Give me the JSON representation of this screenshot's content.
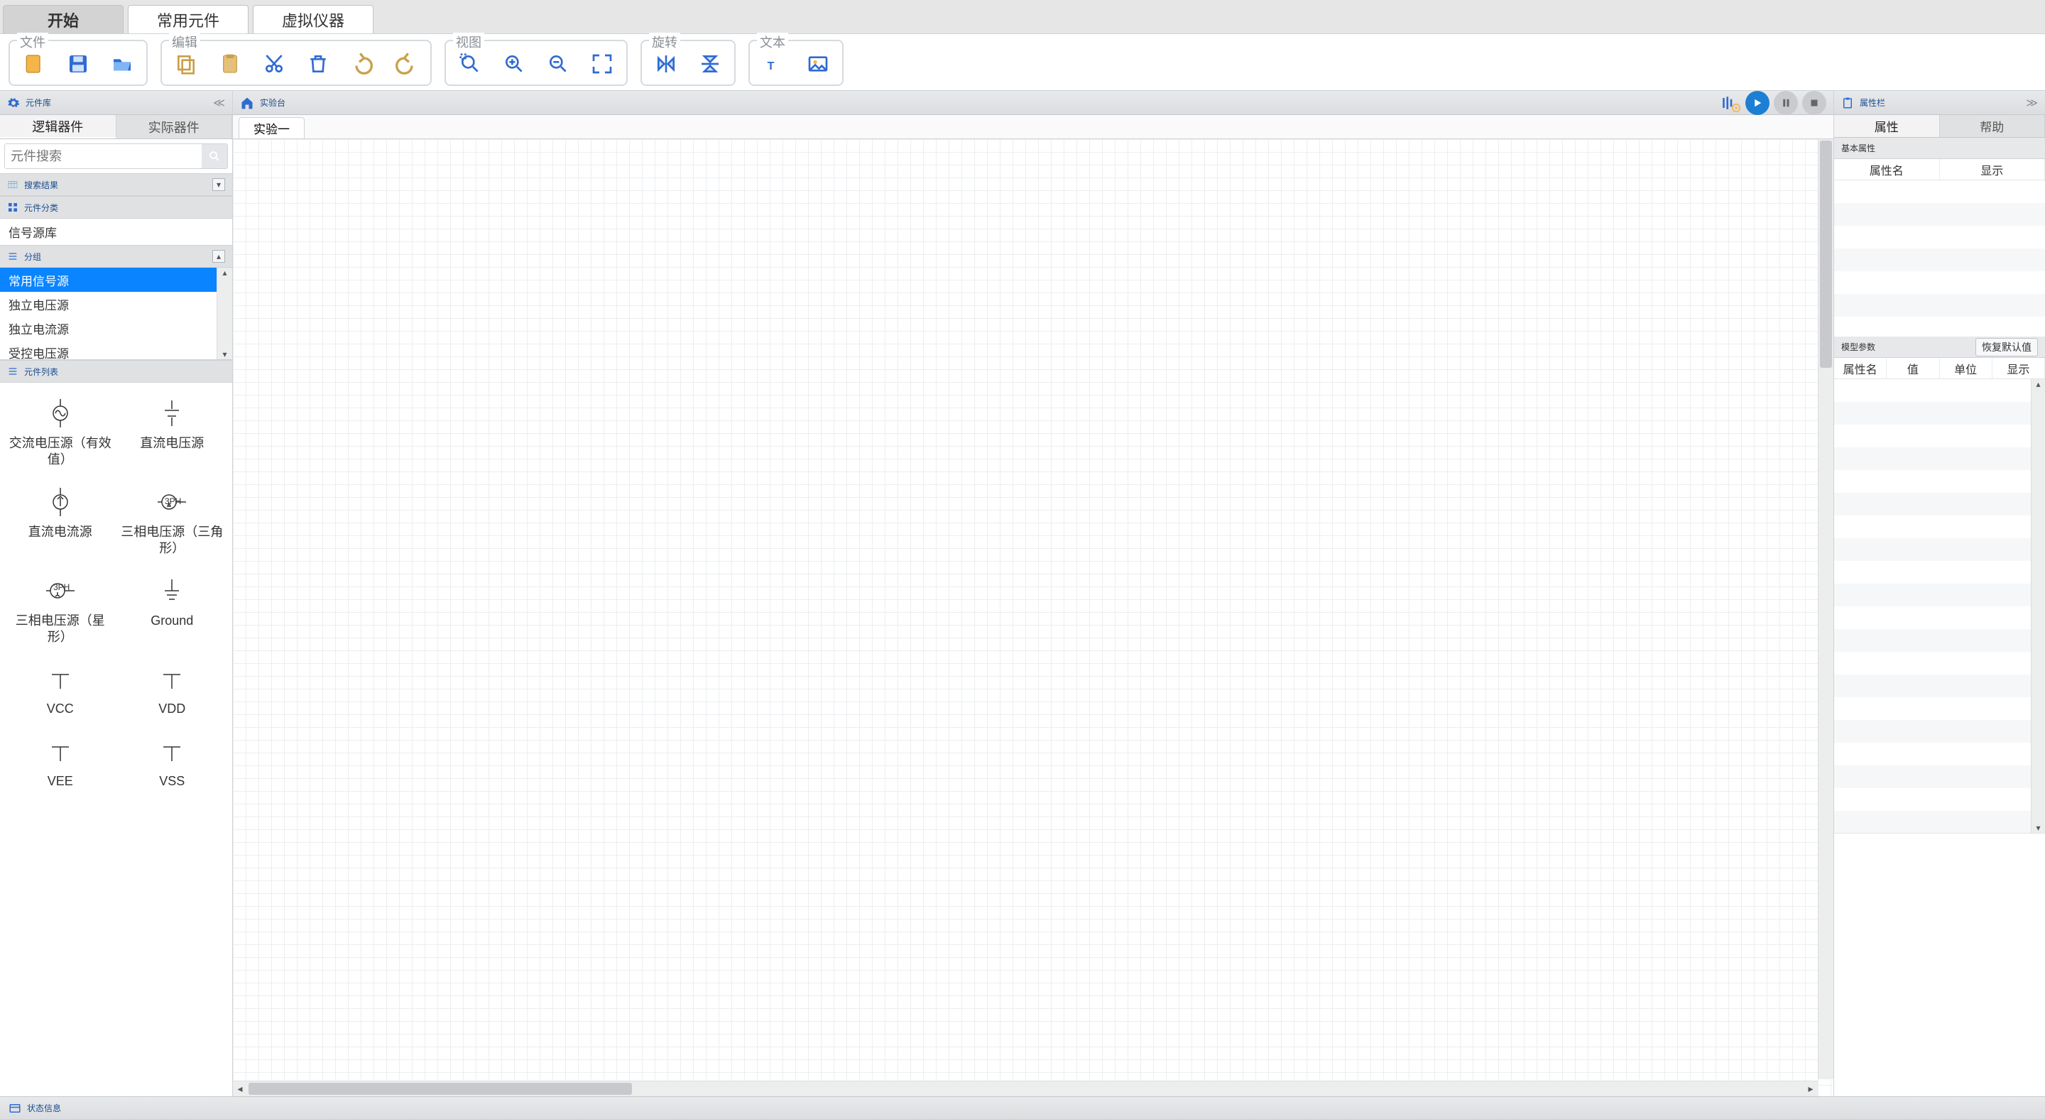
{
  "ribbonTabs": {
    "start": "开始",
    "common": "常用元件",
    "instruments": "虚拟仪器"
  },
  "groups": {
    "file": "文件",
    "edit": "编辑",
    "view": "视图",
    "rotate": "旋转",
    "text": "文本"
  },
  "left": {
    "library_title": "元件库",
    "subtabs": {
      "logic": "逻辑器件",
      "real": "实际器件"
    },
    "search_placeholder": "元件搜索",
    "search_results": "搜索结果",
    "categories": "元件分类",
    "category_current": "信号源库",
    "groups_title": "分组",
    "group_items": [
      "常用信号源",
      "独立电压源",
      "独立电流源",
      "受控电压源"
    ],
    "component_list": "元件列表",
    "components": [
      "交流电压源（有效值）",
      "直流电压源",
      "直流电流源",
      "三相电压源（三角形）",
      "三相电压源（星形）",
      "Ground",
      "VCC",
      "VDD",
      "VEE",
      "VSS"
    ]
  },
  "center": {
    "workbench": "实验台",
    "tab": "实验一"
  },
  "right": {
    "title": "属性栏",
    "tabs": {
      "attr": "属性",
      "help": "帮助"
    },
    "basic": "基本属性",
    "attr_name": "属性名",
    "attr_show": "显示",
    "model": "模型参数",
    "restore": "恢复默认值",
    "m_name": "属性名",
    "m_val": "值",
    "m_unit": "单位",
    "m_show": "显示"
  },
  "status": "状态信息"
}
